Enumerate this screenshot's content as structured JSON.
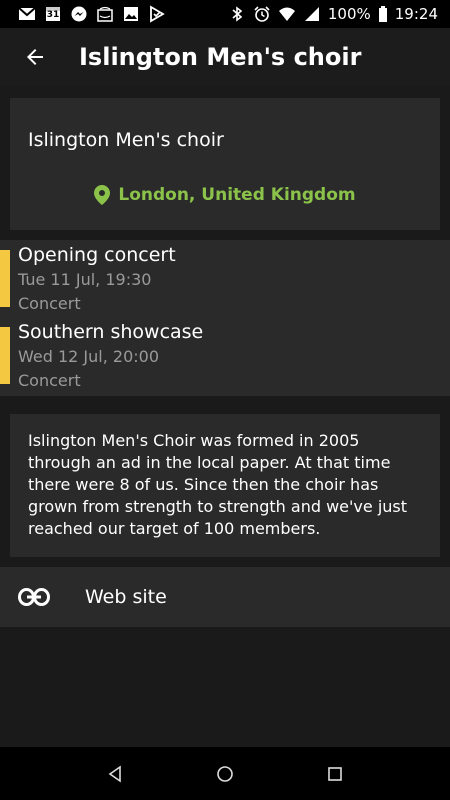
{
  "status_bar": {
    "icons": [
      "gmail-icon",
      "calendar-icon",
      "messenger-icon",
      "amazon-icon",
      "image-icon",
      "task-icon",
      "bluetooth-icon",
      "alarm-icon",
      "wifi-icon",
      "signal-icon",
      "battery-icon"
    ],
    "calendar_day": "31",
    "battery": "100%",
    "time": "19:24"
  },
  "app_bar": {
    "title": "Islington Men's choir",
    "back_icon": "arrow-back-icon"
  },
  "header_card": {
    "name": "Islington Men's choir",
    "location": "London, United Kingdom",
    "location_icon": "map-pin-icon",
    "accent_color": "#8bc34a"
  },
  "events": [
    {
      "title": "Opening concert",
      "date": "Tue 11 Jul, 19:30",
      "type": "Concert"
    },
    {
      "title": "Southern showcase",
      "date": "Wed 12 Jul, 20:00",
      "type": "Concert"
    }
  ],
  "event_marker_color": "#f5c842",
  "description": "Islington Men's Choir was formed in 2005 through an ad in the local paper. At that time there were 8 of us. Since then the choir has grown from strength to strength and we've just reached our target of 100 members.",
  "website": {
    "label": "Web site",
    "icon": "link-icon"
  },
  "nav_bar": {
    "buttons": [
      "back-triangle-icon",
      "home-circle-icon",
      "recents-square-icon"
    ]
  }
}
